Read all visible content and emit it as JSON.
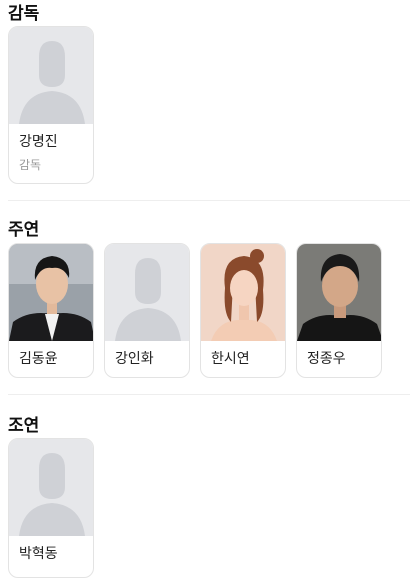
{
  "sections": [
    {
      "title": "감독",
      "people": [
        {
          "name": "강명진",
          "role": "감독",
          "photo": "placeholder"
        }
      ]
    },
    {
      "title": "주연",
      "people": [
        {
          "name": "김동윤",
          "photo": "man-suit"
        },
        {
          "name": "강인화",
          "photo": "placeholder"
        },
        {
          "name": "한시연",
          "photo": "woman-peach"
        },
        {
          "name": "정종우",
          "photo": "man-dark"
        }
      ]
    },
    {
      "title": "조연",
      "people": [
        {
          "name": "박혁동",
          "photo": "placeholder"
        }
      ]
    }
  ],
  "colors": {
    "placeholder_bg": "#e6e7ea",
    "placeholder_silhouette": "#cfd1d6"
  }
}
